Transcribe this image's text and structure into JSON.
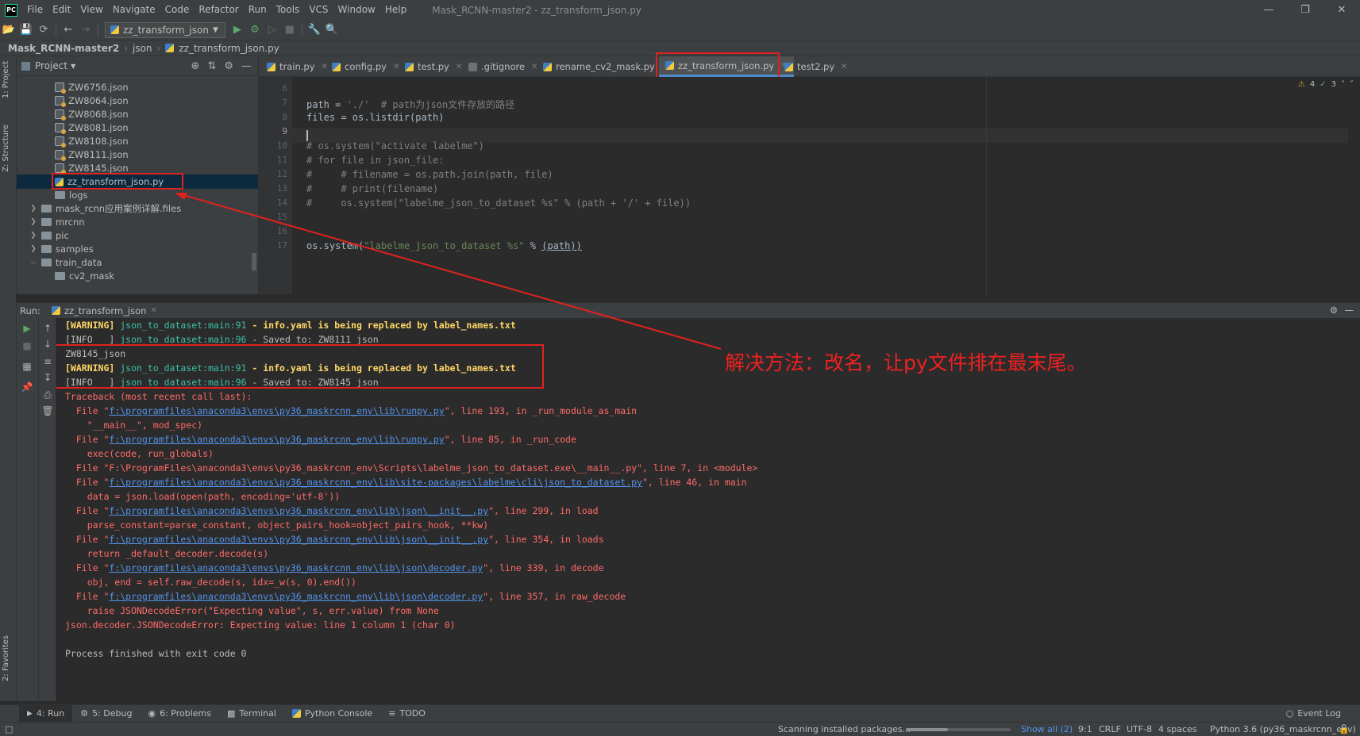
{
  "app": {
    "logo": "PC",
    "window_title": "Mask_RCNN-master2 - zz_transform_json.py",
    "menu": [
      "File",
      "Edit",
      "View",
      "Navigate",
      "Code",
      "Refactor",
      "Run",
      "Tools",
      "VCS",
      "Window",
      "Help"
    ]
  },
  "toolbar": {
    "run_config": "zz_transform_json"
  },
  "breadcrumb": [
    "Mask_RCNN-master2",
    "json",
    "zz_transform_json.py"
  ],
  "left_strip": {
    "project_label": "1: Project",
    "structure_label": "Z: Structure",
    "favorites_label": "2: Favorites"
  },
  "project": {
    "title": "Project",
    "files": [
      "ZW6756.json",
      "ZW8064.json",
      "ZW8068.json",
      "ZW8081.json",
      "ZW8108.json",
      "ZW8111.json",
      "ZW8145.json",
      "zz_transform_json.py"
    ],
    "folders": [
      "logs",
      "mask_rcnn应用案例详解.files",
      "mrcnn",
      "pic",
      "samples",
      "train_data",
      "cv2_mask"
    ]
  },
  "editor": {
    "tabs": [
      "train.py",
      "config.py",
      "test.py",
      ".gitignore",
      "rename_cv2_mask.py",
      "zz_transform_json.py",
      "test2.py"
    ],
    "inspections": {
      "warnings": "4",
      "ok": "3"
    },
    "line_numbers": [
      "6",
      "7",
      "8",
      "9",
      "10",
      "11",
      "12",
      "13",
      "14",
      "15",
      "16",
      "17"
    ],
    "code": {
      "l7a": "path = ",
      "l7b": "'./'",
      "l7c": "  # path为json文件存放的路径",
      "l8": "files = os.listdir(path)",
      "l10": "# os.system(\"activate labelme\")",
      "l11": "# for file in json_file:",
      "l12": "#     # filename = os.path.join(path, file)",
      "l13": "#     # print(filename)",
      "l14": "#     os.system(\"labelme_json_to_dataset %s\" % (path + '/' + file))",
      "l17a": "os.system(",
      "l17b": "\"labelme_json_to_dataset %s\"",
      "l17c": " % ",
      "l17d": "(path))"
    }
  },
  "run": {
    "label": "Run:",
    "tab": "zz_transform_json"
  },
  "console": {
    "w1_tag": "[WARNING]",
    "w1_src": " json_to_dataset:main:91",
    "w1_msg": " - info.yaml is being replaced by label_names.txt",
    "i1_tag": "[INFO   ]",
    "i1_src": " json_to_dataset:main:96",
    "i1_msg": " - Saved to: ZW8111_json",
    "zw": "ZW8145_json",
    "w2_tag": "[WARNING]",
    "w2_src": " json_to_dataset:main:91",
    "w2_msg": " - info.yaml is being replaced by label_names.txt",
    "i2_tag": "[INFO   ]",
    "i2_src": " json_to_dataset:main:96",
    "i2_msg": " - Saved to: ZW8145_json",
    "tb": "Traceback (most recent call last):",
    "f1a": "  File \"",
    "f1b": "f:\\programfiles\\anaconda3\\envs\\py36_maskrcnn_env\\lib\\runpy.py",
    "f1c": "\", line 193, in _run_module_as_main",
    "f1d": "    \"__main__\", mod_spec)",
    "f2b": "f:\\programfiles\\anaconda3\\envs\\py36_maskrcnn_env\\lib\\runpy.py",
    "f2c": "\", line 85, in _run_code",
    "f2d": "    exec(code, run_globals)",
    "f3": "  File \"F:\\ProgramFiles\\anaconda3\\envs\\py36_maskrcnn_env\\Scripts\\labelme_json_to_dataset.exe\\__main__.py\", line 7, in <module>",
    "f4b": "f:\\programfiles\\anaconda3\\envs\\py36_maskrcnn_env\\lib\\site-packages\\labelme\\cli\\json_to_dataset.py",
    "f4c": "\", line 46, in main",
    "f4d": "    data = json.load(open(path, encoding='utf-8'))",
    "f5b": "f:\\programfiles\\anaconda3\\envs\\py36_maskrcnn_env\\lib\\json\\__init__.py",
    "f5c": "\", line 299, in load",
    "f5d": "    parse_constant=parse_constant, object_pairs_hook=object_pairs_hook, **kw)",
    "f6b": "f:\\programfiles\\anaconda3\\envs\\py36_maskrcnn_env\\lib\\json\\__init__.py",
    "f6c": "\", line 354, in loads",
    "f6d": "    return _default_decoder.decode(s)",
    "f7b": "f:\\programfiles\\anaconda3\\envs\\py36_maskrcnn_env\\lib\\json\\decoder.py",
    "f7c": "\", line 339, in decode",
    "f7d": "    obj, end = self.raw_decode(s, idx=_w(s, 0).end())",
    "f8b": "f:\\programfiles\\anaconda3\\envs\\py36_maskrcnn_env\\lib\\json\\decoder.py",
    "f8c": "\", line 357, in raw_decode",
    "f8d": "    raise JSONDecodeError(\"Expecting value\", s, err.value) from None",
    "err": "json.decoder.JSONDecodeError: Expecting value: line 1 column 1 (char 0)",
    "done": "Process finished with exit code 0"
  },
  "annotation": "解决方法：改名，让py文件排在最末尾。",
  "bottom_tabs": [
    "4: Run",
    "5: Debug",
    "6: Problems",
    "Terminal",
    "Python Console",
    "TODO"
  ],
  "event_log": "Event Log",
  "status": {
    "scanning": "Scanning installed packages...",
    "show_all": "Show all (2)",
    "position": "9:1",
    "line_sep": "CRLF",
    "encoding": "UTF-8",
    "indent": "4 spaces",
    "interpreter": "Python 3.6 (py36_maskrcnn_env)",
    "scan_progress": 0.4
  },
  "colors": {
    "accent": "#4a88c7",
    "annotation_red": "#e0221e"
  }
}
